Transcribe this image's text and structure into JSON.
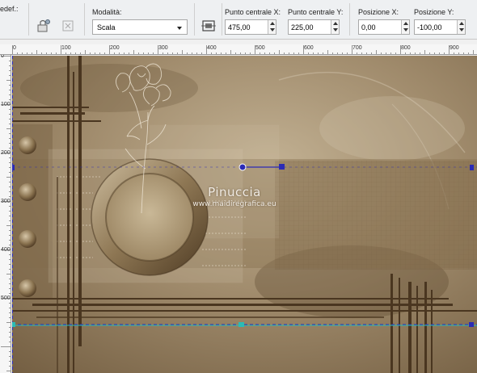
{
  "toolbar": {
    "preset_label": "edef.:",
    "mode_label": "Modalità:",
    "mode_value": "Scala",
    "center_x_label": "Punto centrale X:",
    "center_x_value": "475,00",
    "center_y_label": "Punto centrale Y:",
    "center_y_value": "225,00",
    "pos_x_label": "Posizione X:",
    "pos_x_value": "0,00",
    "pos_y_label": "Posizione Y:",
    "pos_y_value": "-100,00",
    "icons": [
      "preset-icon",
      "reset-icon",
      "crop-to-layer-icon"
    ]
  },
  "ruler": {
    "h_labels": [
      "0",
      "100",
      "200",
      "300",
      "400",
      "500",
      "600",
      "700",
      "800",
      "900"
    ],
    "v_labels": [
      "0",
      "100",
      "200",
      "300",
      "400",
      "500"
    ]
  },
  "canvas": {
    "watermark_title": "Pinuccia",
    "watermark_url": "www.maidiregrafica.eu",
    "colors": {
      "background": "#a08b6c",
      "dark": "#4a3620",
      "light": "#d9ccb5",
      "guide": "#2a7fd4",
      "handle": "#2b2bb5"
    }
  }
}
